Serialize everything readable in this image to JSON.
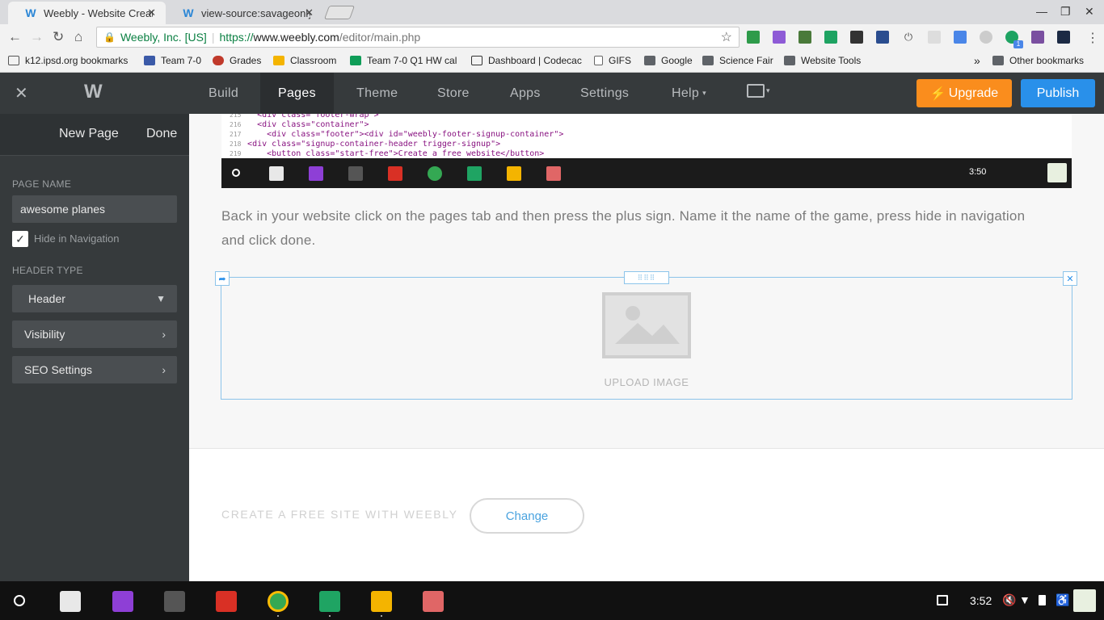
{
  "browser": {
    "tabs": [
      {
        "title": "Weebly - Website Creatio",
        "active": true
      },
      {
        "title": "view-source:savageonly.",
        "active": false
      }
    ],
    "omnibox": {
      "org": "Weebly, Inc. [US]",
      "scheme": "https://",
      "host": "www.weebly.com",
      "path": "/editor/main.php"
    },
    "bookmarks": [
      "k12.ipsd.org bookmarks",
      "Team 7-0",
      "Grades",
      "Classroom",
      "Team 7-0 Q1 HW cal",
      "Dashboard | Codecac",
      "GIFS",
      "Google",
      "Science Fair",
      "Website Tools"
    ],
    "bookmarks_overflow": "»",
    "other_bookmarks": "Other bookmarks",
    "ext_badge": "1"
  },
  "editor": {
    "nav": [
      "Build",
      "Pages",
      "Theme",
      "Store",
      "Apps",
      "Settings",
      "Help"
    ],
    "active_nav": "Pages",
    "upgrade_label": "Upgrade",
    "publish_label": "Publish"
  },
  "sidebar": {
    "new_page": "New Page",
    "done": "Done",
    "page_name_label": "PAGE NAME",
    "page_name_value": "awesome planes",
    "hide_nav_label": "Hide in Navigation",
    "hide_nav_checked": true,
    "header_type_label": "HEADER TYPE",
    "header_type_value": "Header",
    "visibility_label": "Visibility",
    "seo_label": "SEO Settings"
  },
  "content": {
    "code_lines": [
      {
        "ln": "216",
        "html": "<div class=\"container\">"
      },
      {
        "ln": "217",
        "html": "<div class=\"footer\"><div id=\"weebly-footer-signup-container\">"
      },
      {
        "ln": "218",
        "html": "<div class=\"signup-container-header trigger-signup\">"
      },
      {
        "ln": "219",
        "html": "<button class=\"start-free\">Create a free website</button>"
      }
    ],
    "inner_time": "3:50",
    "description": "Back in your website click on the pages tab and then press the plus sign. Name it the name of the game, press hide in navigation and click done.",
    "upload_label": "UPLOAD IMAGE",
    "footer_text": "CREATE A FREE SITE WITH WEEBLY",
    "change_label": "Change"
  },
  "shelf": {
    "time": "3:52"
  },
  "colors": {
    "weebly_header": "#363a3c",
    "upgrade": "#fa8d1d",
    "publish": "#2990ea",
    "selection_border": "#8cc4ea"
  }
}
